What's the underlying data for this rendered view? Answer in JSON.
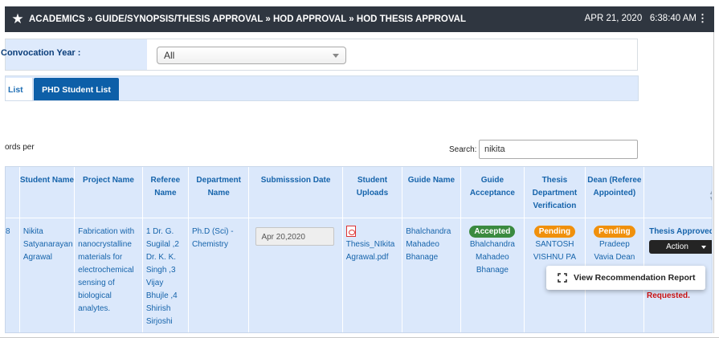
{
  "header": {
    "breadcrumb": "ACADEMICS » GUIDE/SYNOPSIS/THESIS APPROVAL » HOD APPROVAL » HOD THESIS APPROVAL",
    "date": "APR 21, 2020",
    "time": "6:38:40 AM"
  },
  "filter": {
    "label": "Convocation Year :",
    "selected": "All"
  },
  "tabs": [
    {
      "label": "List"
    },
    {
      "label": "PHD Student List"
    }
  ],
  "list_controls": {
    "records_text": "ords per",
    "search_label": "Search:",
    "search_value": "nikita"
  },
  "table": {
    "headers": [
      "Student Name",
      "Project Name",
      "Referee Name",
      "Department Name",
      "Submisssion Date",
      "Student Uploads",
      "Guide Name",
      "Guide Acceptance",
      "Thesis Department Verification",
      "Dean (Referee Appointed)"
    ],
    "row": {
      "sr": "8",
      "student_name": "Nikita Satyanarayan Agrawal",
      "project_name": "Fabrication with nanocrystalline materials for electrochemical sensing of biological analytes.",
      "referee_name": "1 Dr. G. Sugilal ,2 Dr. K. K. Singh ,3 Vijay Bhujle ,4 Shirish Sirjoshi",
      "department": "Ph.D (Sci) - Chemistry",
      "submission_date": "Apr 20,2020",
      "upload_file": "Thesis_NIkita Agrawal.pdf",
      "guide_name": "Bhalchandra Mahadeo Bhanage",
      "guide_acceptance_badge": "Accepted",
      "guide_acceptance_name": "Bhalchandra Mahadeo Bhanage",
      "dept_verification_badge": "Pending",
      "dept_verification_name": "SANTOSH VISHNU PA",
      "dean_badge": "Pending",
      "dean_name": "Pradeep Vavia Dean",
      "thesis_status": "Thesis Approved",
      "action_label": "Action",
      "requested_text": "Requested."
    }
  },
  "dropdown": {
    "item": "View Recommendation Report"
  },
  "colors": {
    "header_bg": "#2f3640",
    "panel_bg": "#deeafc",
    "active_tab": "#0d5fa8",
    "link_text": "#1664ab",
    "accepted": "#3a8a3f",
    "pending": "#f0900c"
  }
}
